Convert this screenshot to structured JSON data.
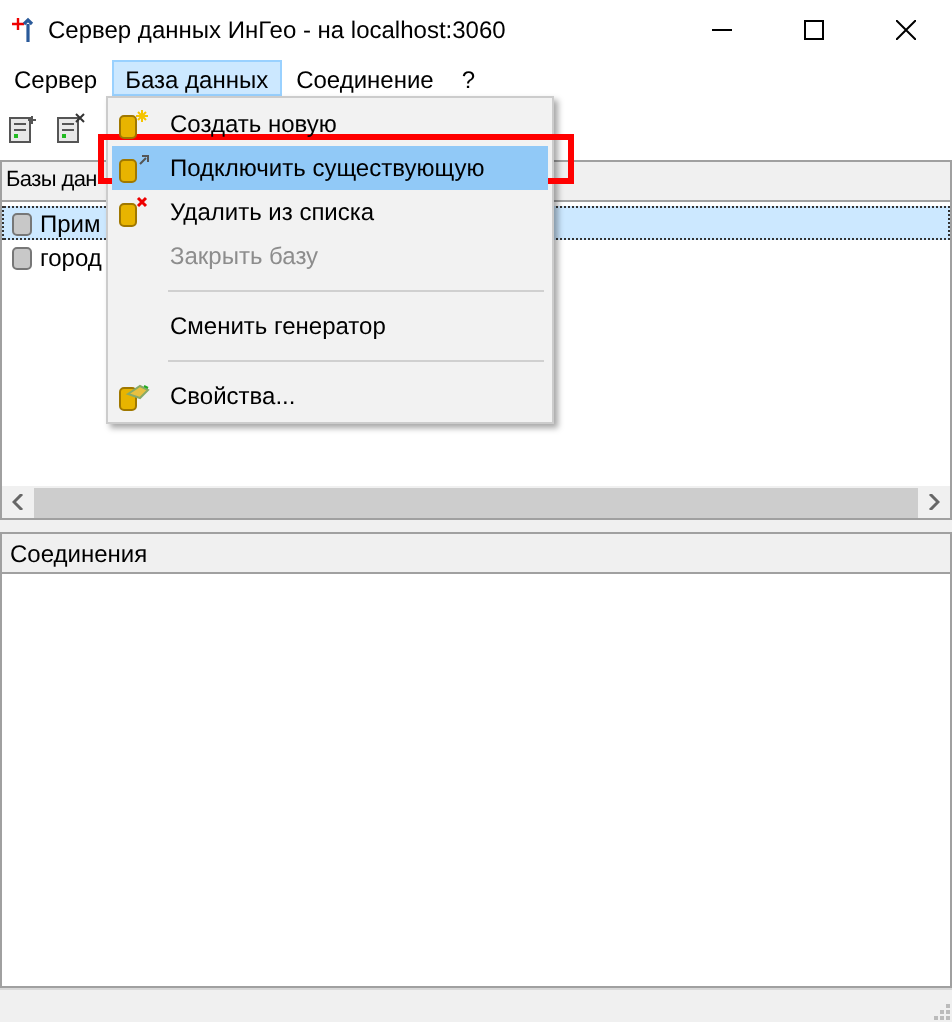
{
  "window": {
    "title": "Сервер данных ИнГео - на localhost:3060"
  },
  "menu_bar": [
    {
      "label": "Сервер",
      "selected": false
    },
    {
      "label": "База данных",
      "selected": true
    },
    {
      "label": "Соединение",
      "selected": false
    },
    {
      "label": "?",
      "selected": false
    }
  ],
  "databases_panel": {
    "header": "Базы дан",
    "rows": [
      {
        "label": "Прим",
        "selected": true
      },
      {
        "label": "город",
        "selected": false
      }
    ]
  },
  "connections_panel": {
    "header": "Соединения"
  },
  "dropdown_menu": [
    {
      "kind": "item",
      "label": "Создать новую",
      "disabled": false,
      "hovered": false,
      "outlined": false
    },
    {
      "kind": "item",
      "label": "Подключить существующую",
      "disabled": false,
      "hovered": true,
      "outlined": true
    },
    {
      "kind": "item",
      "label": "Удалить из списка",
      "disabled": false,
      "hovered": false,
      "outlined": false
    },
    {
      "kind": "item",
      "label": "Закрыть базу",
      "disabled": true,
      "hovered": false,
      "outlined": false
    },
    {
      "kind": "separator"
    },
    {
      "kind": "item",
      "label": "Сменить генератор",
      "disabled": false,
      "hovered": false,
      "outlined": false
    },
    {
      "kind": "separator"
    },
    {
      "kind": "item",
      "label": "Свойства...",
      "disabled": false,
      "hovered": false,
      "outlined": false
    }
  ]
}
